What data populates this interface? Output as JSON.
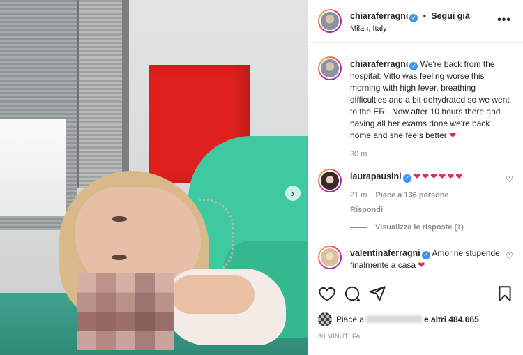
{
  "post": {
    "username": "chiaraferragni",
    "follow_label": "Segui già",
    "location": "Milan, Italy",
    "more_label": "•••"
  },
  "caption": {
    "username": "chiaraferragni",
    "text": "We're back from the hospital: Vitto was feeling worse this morning with high fever, breathing difficulties and a bit dehydrated so we went to the ER.. Now after 10 hours there and having all her exams done we're back home and she feels better",
    "emoji": "❤",
    "time": "30 m"
  },
  "comments": [
    {
      "username": "laurapausini",
      "text": "❤❤❤❤❤❤",
      "time": "21 m",
      "likes": "Piace a 136 persone",
      "reply": "Rispondi"
    },
    {
      "username": "valentinaferragni",
      "text": "Amorine stupende finalmente a casa",
      "emoji": "❤"
    }
  ],
  "view_replies": "Visualizza le risposte (1)",
  "likes": {
    "prefix": "Piace a",
    "suffix": "e altri 484.665"
  },
  "timestamp": "30 MINUTI FA",
  "colors": {
    "verified": "#3897f0",
    "heart": "#e0245e",
    "muted": "#8e8e8e",
    "text": "#262626"
  },
  "icons": [
    "heart-icon",
    "comment-icon",
    "share-icon",
    "bookmark-icon",
    "more-icon",
    "chevron-right-icon",
    "verified-icon"
  ]
}
